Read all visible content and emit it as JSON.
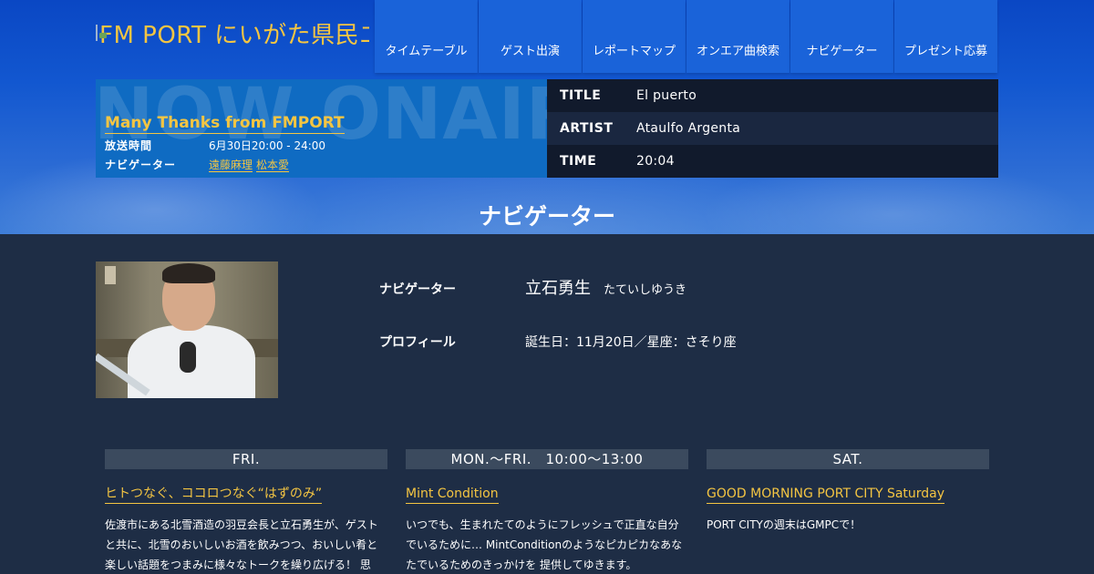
{
  "header": {
    "logo_alt": "FM PORT にいがた県民エフエム放送"
  },
  "nav": {
    "items": [
      {
        "label": "タイムテーブル"
      },
      {
        "label": "ゲスト出演"
      },
      {
        "label": "レポートマップ"
      },
      {
        "label": "オンエア曲検索"
      },
      {
        "label": "ナビゲーター"
      },
      {
        "label": "プレゼント応募"
      }
    ]
  },
  "now_on_air": {
    "bg_text": "NOW ONAIR",
    "program_title": "Many Thanks from FMPORT",
    "time_label": "放送時間",
    "time_value": "6月30日20:00 - 24:00",
    "navigator_label": "ナビゲーター",
    "navigators": [
      "遠藤麻理",
      "松本愛"
    ]
  },
  "now_playing": {
    "title_label": "TITLE",
    "title_value": "El puerto",
    "artist_label": "ARTIST",
    "artist_value": "Ataulfo Argenta",
    "time_label": "TIME",
    "time_value": "20:04"
  },
  "page": {
    "heading": "ナビゲーター"
  },
  "profile": {
    "navigator_label": "ナビゲーター",
    "name": "立石勇生",
    "name_kana": "たていしゆうき",
    "profile_label": "プロフィール",
    "profile_value": "誕生日：11月20日／星座：さそり座"
  },
  "programs": [
    {
      "day": "FRI.",
      "title": "ヒトつなぐ、ココロつなぐ“はずのみ”",
      "description": "佐渡市にある北雪酒造の羽豆会長と立石勇生が、ゲストと共に、北雪のおいしいお酒を飲みつつ、おいしい肴と楽しい話題をつまみに様々なトークを繰り広げる！ 思"
    },
    {
      "day": "MON.～FRI.　10:00～13:00",
      "title": "Mint Condition",
      "description": "いつでも、生まれたてのようにフレッシュで正直な自分でいるために… MintConditionのようなピカピカなあなたでいるためのきっかけを 提供してゆきます。"
    },
    {
      "day": "SAT.",
      "title": "GOOD MORNING PORT CITY Saturday",
      "description": "PORT CITYの週末はGMPCで！"
    }
  ],
  "colors": {
    "accent": "#f4c542",
    "nav_bg": "#1a63d9",
    "panel_bg": "#0f6bc2",
    "page_bg": "#1e2d45",
    "col_head_bg": "#3b4a5e"
  }
}
